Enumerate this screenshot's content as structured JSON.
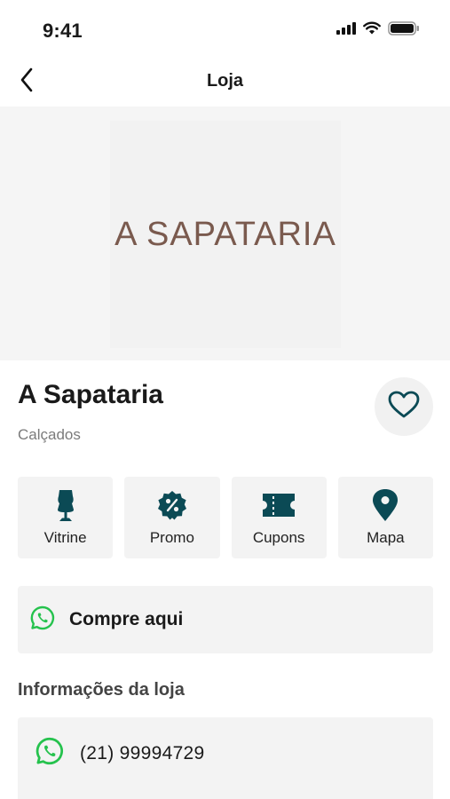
{
  "status_bar": {
    "time": "9:41",
    "icons": [
      "signal-icon",
      "wifi-icon",
      "battery-icon"
    ]
  },
  "nav": {
    "title": "Loja",
    "back_icon": "chevron-left-icon"
  },
  "banner": {
    "logo_text": "A SAPATARIA",
    "logo_color": "#7a5a4e"
  },
  "store": {
    "name": "A Sapataria",
    "category": "Calçados",
    "favorite_icon": "heart-icon"
  },
  "actions": [
    {
      "label": "Vitrine",
      "icon": "mannequin-icon"
    },
    {
      "label": "Promo",
      "icon": "discount-badge-icon"
    },
    {
      "label": "Cupons",
      "icon": "ticket-icon"
    },
    {
      "label": "Mapa",
      "icon": "map-pin-icon"
    }
  ],
  "buy": {
    "label": "Compre aqui",
    "icon": "whatsapp-icon"
  },
  "info": {
    "heading": "Informações da loja",
    "phone": "(21) 99994729",
    "phone_icon": "whatsapp-icon"
  },
  "colors": {
    "accent": "#0b4a55",
    "whatsapp": "#25c24d",
    "card_bg": "#f3f3f3"
  }
}
